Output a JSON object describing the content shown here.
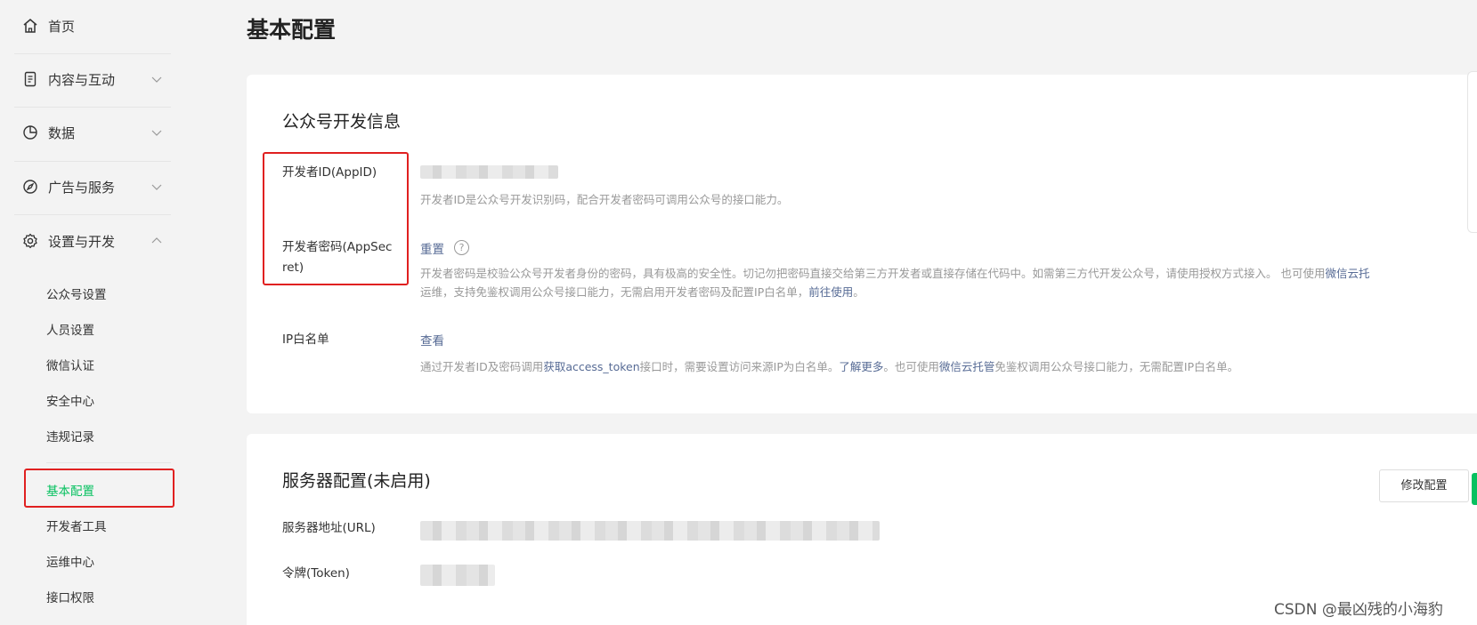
{
  "sidebar": {
    "home": "首页",
    "content": "内容与互动",
    "data": "数据",
    "ads": "广告与服务",
    "settings": "设置与开发",
    "sub_items": [
      "公众号设置",
      "人员设置",
      "微信认证",
      "安全中心",
      "违规记录"
    ],
    "active": "基本配置",
    "dev_items": [
      "开发者工具",
      "运维中心",
      "接口权限"
    ]
  },
  "page": {
    "title": "基本配置"
  },
  "dev_info": {
    "title": "公众号开发信息",
    "appid_label": "开发者ID(AppID)",
    "appid_desc": "开发者ID是公众号开发识别码，配合开发者密码可调用公众号的接口能力。",
    "secret_label_1": "开发者密码(AppSec",
    "secret_label_2": "ret)",
    "secret_action": "重置",
    "help_glyph": "?",
    "secret_desc_1": "开发者密码是校验公众号开发者身份的密码，具有极高的安全性。切记勿把密码直接交给第三方开发者或直接存储在代码中。如需第三方代开发公众号，请使用授权方式接入。 也可使用",
    "secret_desc_1_link": "微信云托",
    "secret_desc_2": "运维，支持免鉴权调用公众号接口能力，无需启用开发者密码及配置IP白名单，",
    "secret_desc_2_link": "前往使用",
    "secret_desc_2_end": "。",
    "ip_label": "IP白名单",
    "ip_action": "查看",
    "ip_desc_a": "通过开发者ID及密码调用",
    "ip_desc_link1": "获取access_token",
    "ip_desc_b": "接口时，需要设置访问来源IP为白名单。",
    "ip_desc_link2": "了解更多",
    "ip_desc_c": "。也可使用",
    "ip_desc_link3": "微信云托管",
    "ip_desc_d": "免鉴权调用公众号接口能力，无需配置IP白名单。"
  },
  "server": {
    "title": "服务器配置(未启用)",
    "edit_button": "修改配置",
    "url_label": "服务器地址(URL)",
    "token_label": "令牌(Token)"
  },
  "watermark": "CSDN @最凶残的小海豹",
  "colors": {
    "accent": "#07c160",
    "link": "#576b95",
    "highlight": "#e02020"
  }
}
